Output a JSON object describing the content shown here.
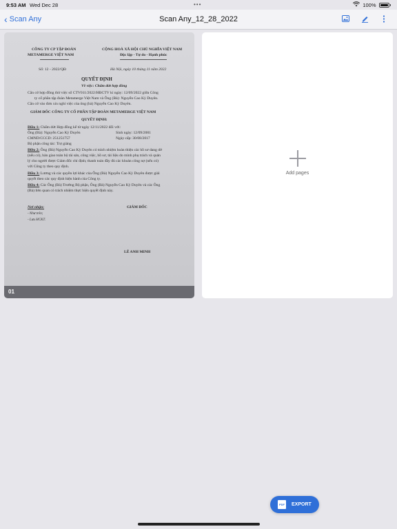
{
  "status": {
    "time": "9:53 AM",
    "date": "Wed Dec 28",
    "more_dots": "•••",
    "battery": "100%"
  },
  "nav": {
    "back_label": "Scan Any",
    "title": "Scan Any_12_28_2022",
    "icons": [
      "image-icon",
      "pen-icon",
      "more-icon"
    ]
  },
  "pages": [
    {
      "index": "01",
      "document": {
        "company_line1": "CÔNG TY CP TẬP ĐOÀN",
        "company_line2": "METAMERGE VIỆT NAM",
        "republic": "CỘNG HOÀ XÃ HỘI CHỦ NGHĨA VIỆT NAM",
        "motto": "Độc lập - Tự do - Hạnh phúc",
        "doc_number": "Số: 12 - 2022/QĐ",
        "place_date": "Hà Nội, ngày 10 tháng 11 năm 2022",
        "heading": "QUYẾT ĐỊNH",
        "subject": "Về việc: Chấm dứt hợp đồng",
        "basis1a": "Căn cứ hợp đồng thử việc số CTV011/2022/HĐCTV kí ngày: 12/09/2022 giữa Công",
        "basis1b": "ty cổ phần tập đoàn Metamerge Việt Nam và Ông (Bà): Nguyễn Cao Kỳ Duyên.",
        "basis2": "Căn cứ vào đơn xin nghỉ việc của ông (bà) Nguyễn Cao Kỳ Duyên.",
        "director_line": "GIÁM ĐỐC CÔNG TY CỔ PHẦN TẬP ĐOÀN METAMERGE VIỆT NAM",
        "decides": "QUYẾT ĐỊNH:",
        "art1_label": "Điều 1:",
        "art1_text": "Chấm dứt Hợp đồng kể từ ngày 12/11/2022 đối với:",
        "person_name": "Ông (Bà): Nguyễn Cao Kỳ Duyên",
        "birth": "Sinh ngày: 12/09/2001",
        "id_number": "CMND/CCCD: 251251757",
        "issued": "Ngày cấp: 30/08/2017",
        "department": "Bộ phận công tác: Trợ giảng",
        "art2_label": "Điều 2:",
        "art2_text_a": "Ông (Bà) Nguyễn Cao Kỳ Duyên có trách nhiệm hoàn thiện các hồ sơ dang dở",
        "art2_text_b": "(nếu có), bàn giao toàn bộ tài sản, công việc, hồ sơ, tài liệu do mình phụ trách và quản",
        "art2_text_c": "lý cho người được Giám đốc chỉ định; thanh toán đầy đủ các khoản công nợ (nếu có)",
        "art2_text_d": "với Công ty theo quy định.",
        "art3_label": "Điều 3:",
        "art3_text_a": "Lương và các quyền lợi khác của Ông (Bà) Nguyễn Cao Kỳ Duyên được giải",
        "art3_text_b": "quyết theo các quy định hiện hành của Công ty.",
        "art4_label": "Điều 4:",
        "art4_text_a": "Các Ông (Bà) Trưởng Bộ phận, Ông (Bà) Nguyễn Cao Kỳ Duyên và các Ông",
        "art4_text_b": "(Bà) liên quan có trách nhiệm thực hiện quyết định này.",
        "recipients_label": "Nơi nhận:",
        "recipient1": "- Như trên;",
        "recipient2": "- Lưu HCKT.",
        "signer_title": "GIÁM ĐỐC",
        "signer_name": "LÊ ANH MINH"
      }
    }
  ],
  "add_pages_label": "Add pages",
  "export": {
    "icon_text": "PDF",
    "label": "EXPORT"
  },
  "colors": {
    "accent": "#2f6fd8",
    "background": "#e7e6eb"
  }
}
